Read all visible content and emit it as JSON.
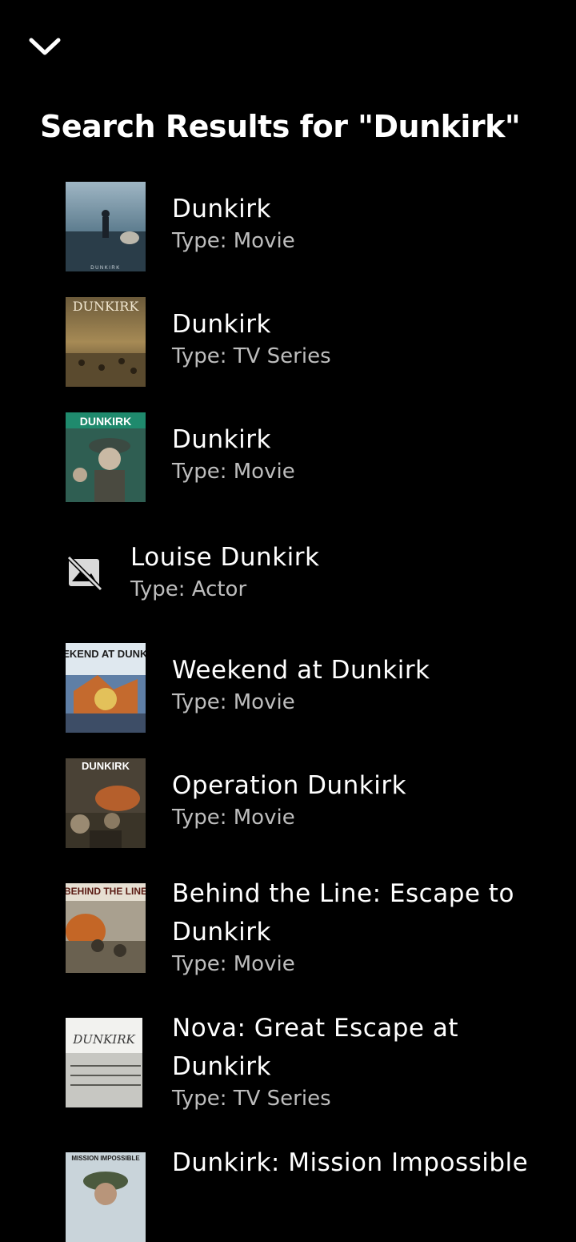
{
  "header": {
    "collapse_icon": "chevron-down-icon",
    "title": "Search Results for \"Dunkirk\""
  },
  "results": [
    {
      "title": "Dunkirk",
      "type": "Type: Movie",
      "poster_text": "DUNKIRK"
    },
    {
      "title": "Dunkirk",
      "type": "Type: TV Series",
      "poster_text": "DUNKIRK"
    },
    {
      "title": "Dunkirk",
      "type": "Type: Movie",
      "poster_text": "DUNKIRK"
    },
    {
      "title": "Louise Dunkirk",
      "type": "Type: Actor",
      "icon": "no-image-icon"
    },
    {
      "title": "Weekend at Dunkirk",
      "type": "Type: Movie",
      "poster_text": "WEEKEND AT DUNKIRK"
    },
    {
      "title": "Operation Dunkirk",
      "type": "Type: Movie",
      "poster_text": "DUNKIRK"
    },
    {
      "title": "Behind the Line: Escape to Dunkirk",
      "type": "Type: Movie",
      "poster_text": "BEHIND THE LINE"
    },
    {
      "title": "Nova: Great Escape at Dunkirk",
      "type": "Type: TV Series",
      "poster_text": "DUNKIRK"
    },
    {
      "title": "Dunkirk: Mission Impossible",
      "type": "",
      "poster_text": "MISSION IMPOSSIBLE"
    }
  ],
  "colors": {
    "background": "#000000",
    "text_primary": "#ffffff",
    "text_secondary": "#bdbdbd"
  }
}
